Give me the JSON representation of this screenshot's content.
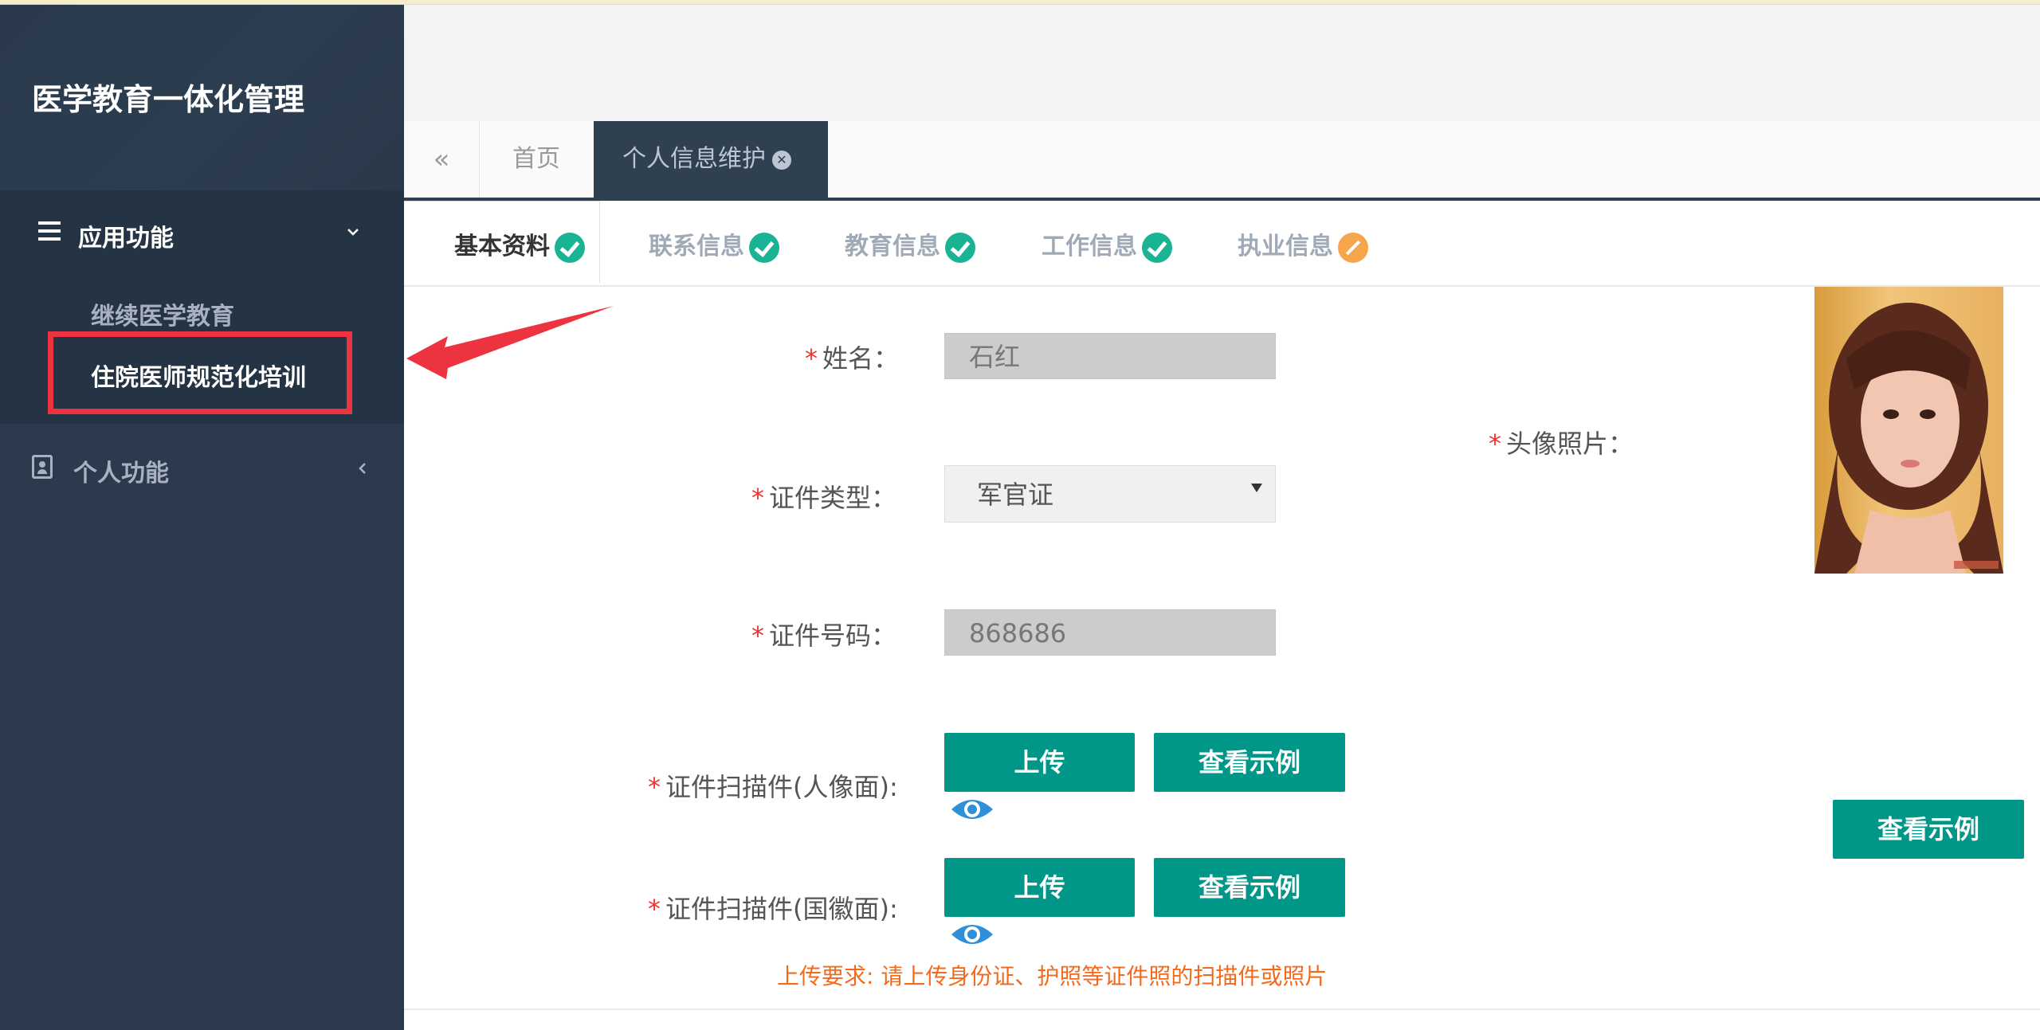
{
  "app": {
    "title": "医学教育一体化管理"
  },
  "sidebar": {
    "sections": [
      {
        "label": "应用功能",
        "items": [
          {
            "label": "继续医学教育"
          },
          {
            "label": "住院医师规范化培训"
          }
        ]
      },
      {
        "label": "个人功能"
      }
    ]
  },
  "tabs": [
    {
      "label": "首页"
    },
    {
      "label": "个人信息维护"
    }
  ],
  "steps": [
    {
      "label": "基本资料",
      "status": "done"
    },
    {
      "label": "联系信息",
      "status": "done"
    },
    {
      "label": "教育信息",
      "status": "done"
    },
    {
      "label": "工作信息",
      "status": "done"
    },
    {
      "label": "执业信息",
      "status": "pending"
    }
  ],
  "form": {
    "required_mark": "*",
    "name": {
      "label": "姓名：",
      "value": "石红"
    },
    "id_type": {
      "label": "证件类型：",
      "value": "军官证"
    },
    "id_number": {
      "label": "证件号码：",
      "value": "868686"
    },
    "scan_front": {
      "label": "证件扫描件(人像面):",
      "upload": "上传",
      "example": "查看示例"
    },
    "scan_back": {
      "label": "证件扫描件(国徽面):",
      "upload": "上传",
      "example": "查看示例"
    },
    "photo": {
      "label": "头像照片：",
      "example": "查看示例"
    },
    "hint": "上传要求: 请上传身份证、护照等证件照的扫描件或照片"
  },
  "colors": {
    "sidebar": "#2b3b4d",
    "accent": "#009688",
    "success": "#1ab394",
    "warning": "#f7a54a",
    "highlight": "#ee3340"
  }
}
